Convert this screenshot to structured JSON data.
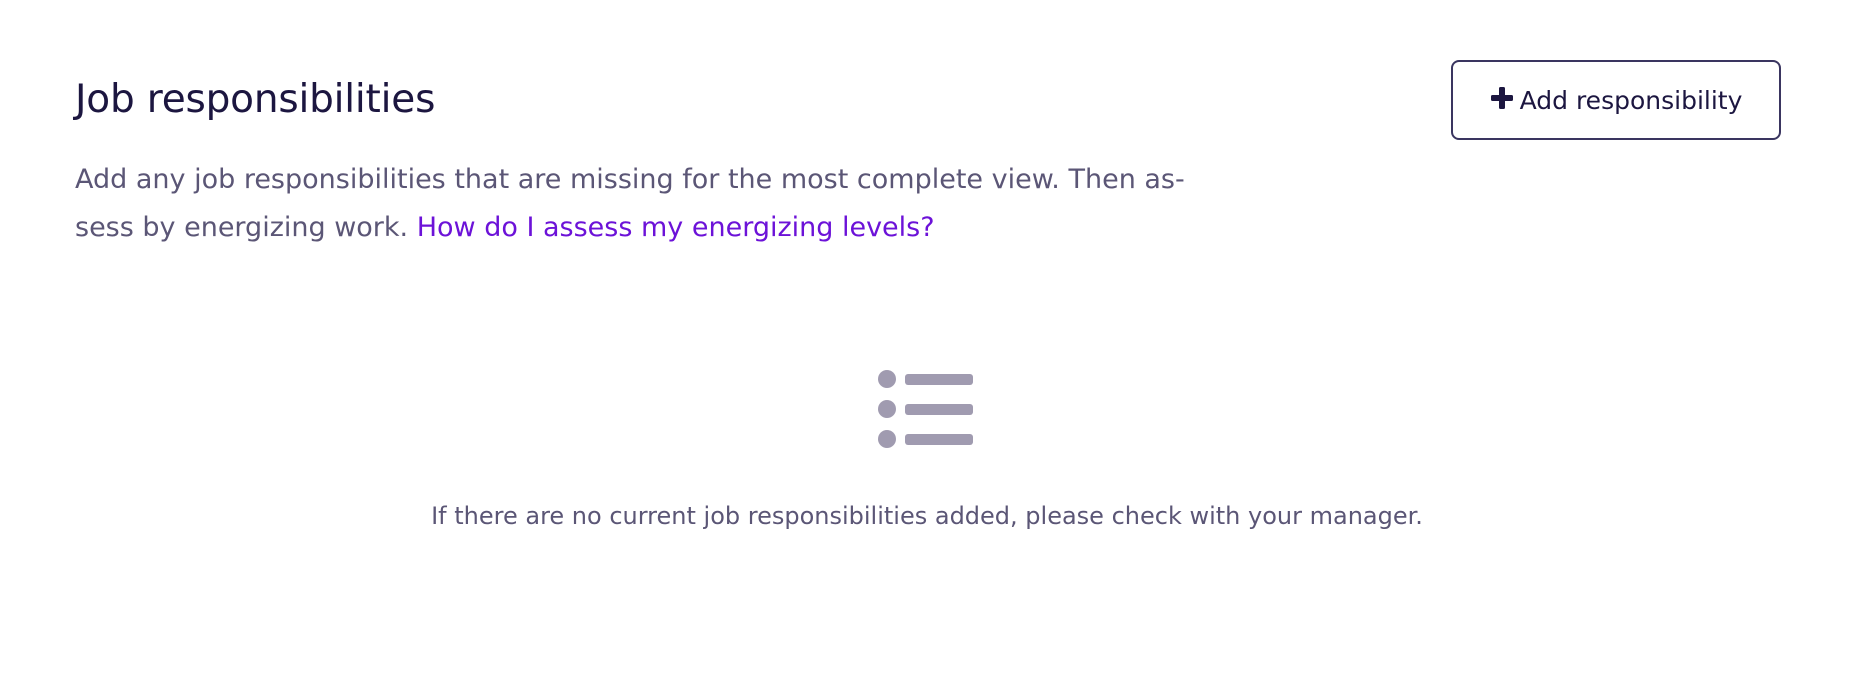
{
  "header": {
    "title": "Job responsibilities",
    "add_button_label": "Add responsibility",
    "add_button_icon": "plus-icon"
  },
  "description": {
    "text": "Add any job responsibilities that are missing for the most complete view. Then as-sess by energizing work. ",
    "link_text": "How do I assess my energizing levels?"
  },
  "empty_state": {
    "icon": "list-icon",
    "message": "If there are no current job responsibilities added, please check with your manager."
  },
  "colors": {
    "title": "#1c1640",
    "body_text": "#5b5676",
    "link": "#6c12d8",
    "button_border": "#3a3560",
    "icon_gray": "#a09bb0"
  }
}
